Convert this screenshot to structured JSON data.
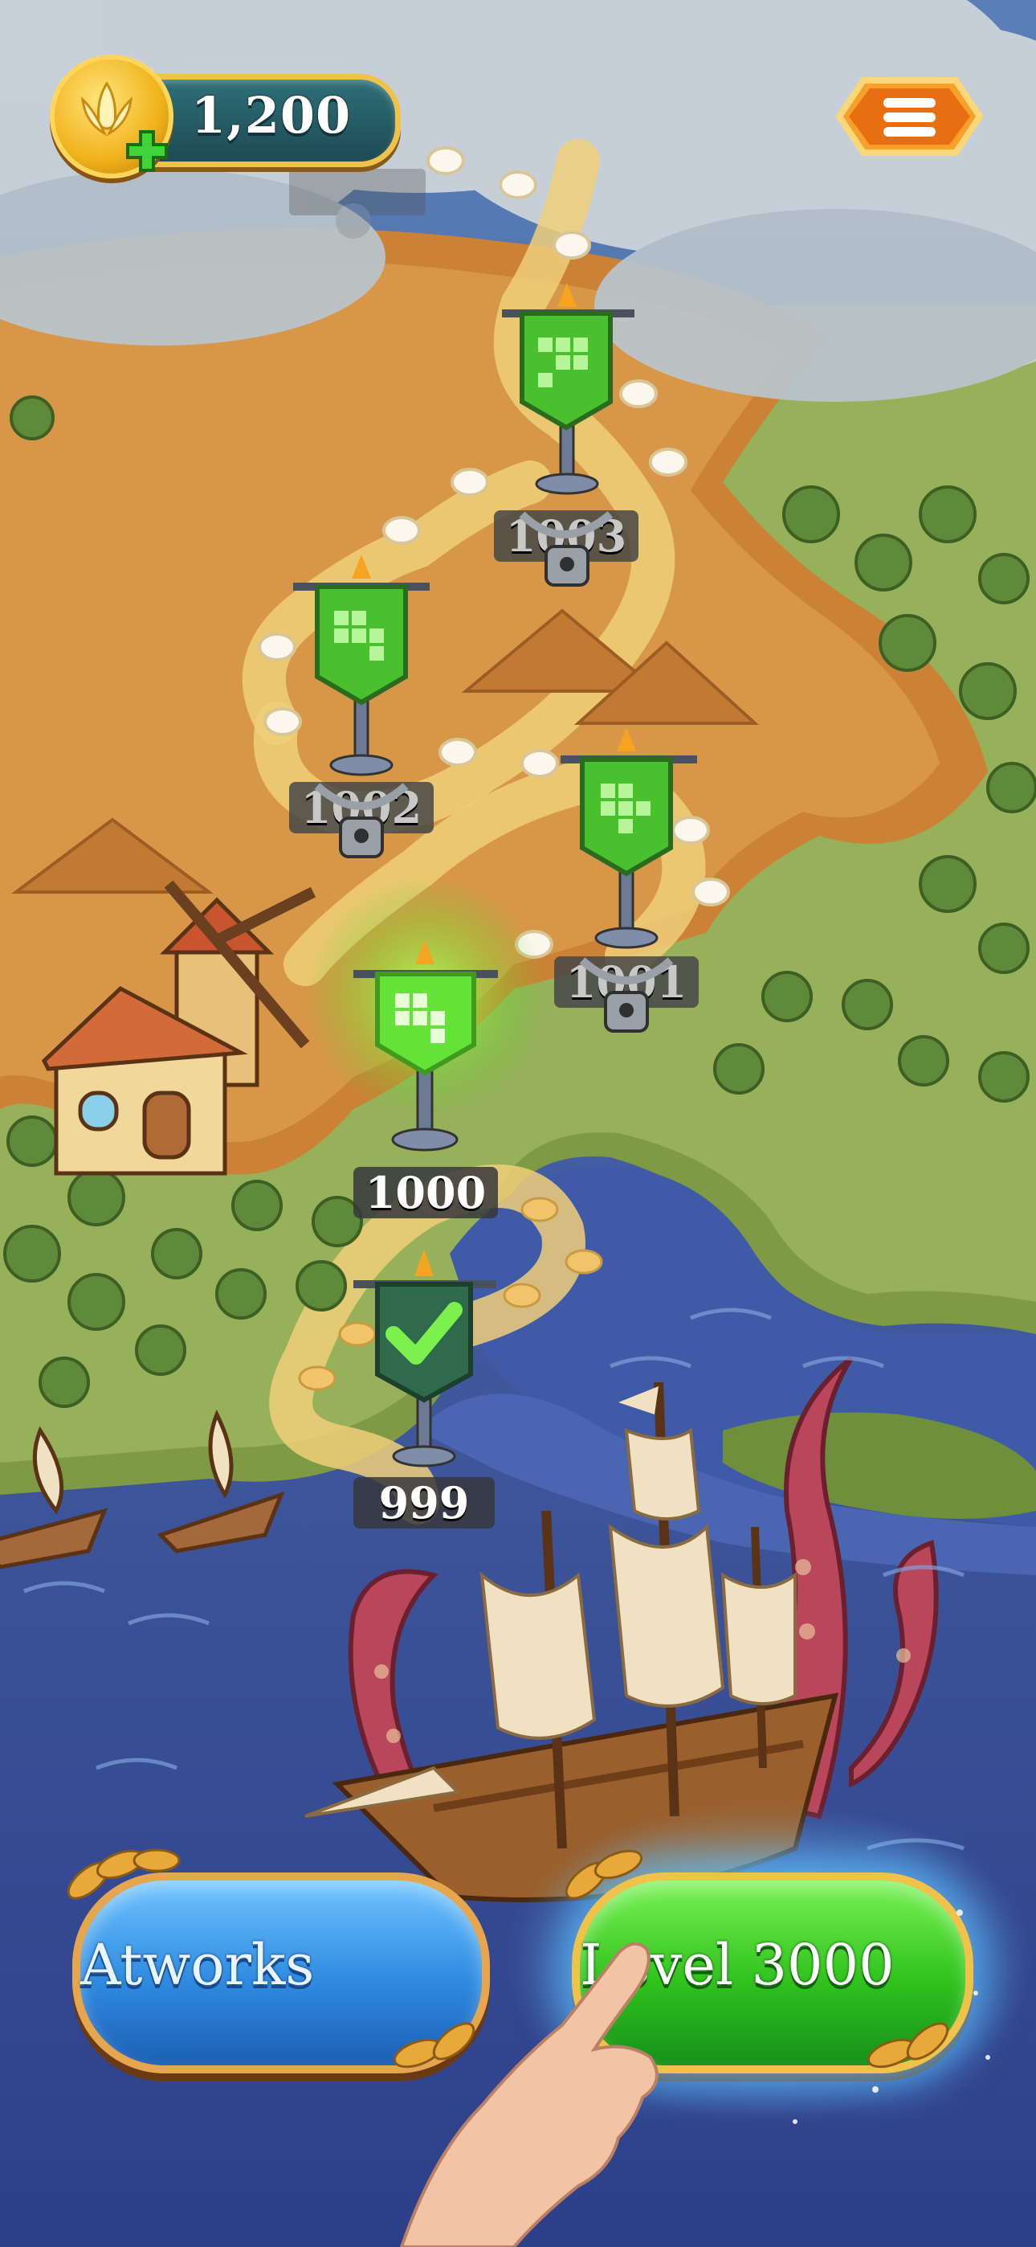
{
  "header": {
    "coins": "1,200",
    "coin_icon": "leaf-coin-icon",
    "add_icon": "plus-icon",
    "menu_icon": "hamburger-menu-icon"
  },
  "levels": [
    {
      "label": "1003",
      "state": "locked",
      "icon": "chain-lock-icon"
    },
    {
      "label": "1002",
      "state": "locked",
      "icon": "chain-lock-icon"
    },
    {
      "label": "1001",
      "state": "locked",
      "icon": "chain-lock-icon"
    },
    {
      "label": "1000",
      "state": "current",
      "icon": "puzzle-banner-icon"
    },
    {
      "label": "999",
      "state": "completed",
      "icon": "checkmark-icon"
    }
  ],
  "fog_level": {
    "label": "1003",
    "state": "hidden"
  },
  "buttons": {
    "artworks_label": "Atworks",
    "level_label": "Level 3000"
  },
  "colors": {
    "accent_green": "#2fc21d",
    "accent_blue": "#2f8ae0",
    "gold": "#f0c24a",
    "sea": "#3a4f9a"
  }
}
